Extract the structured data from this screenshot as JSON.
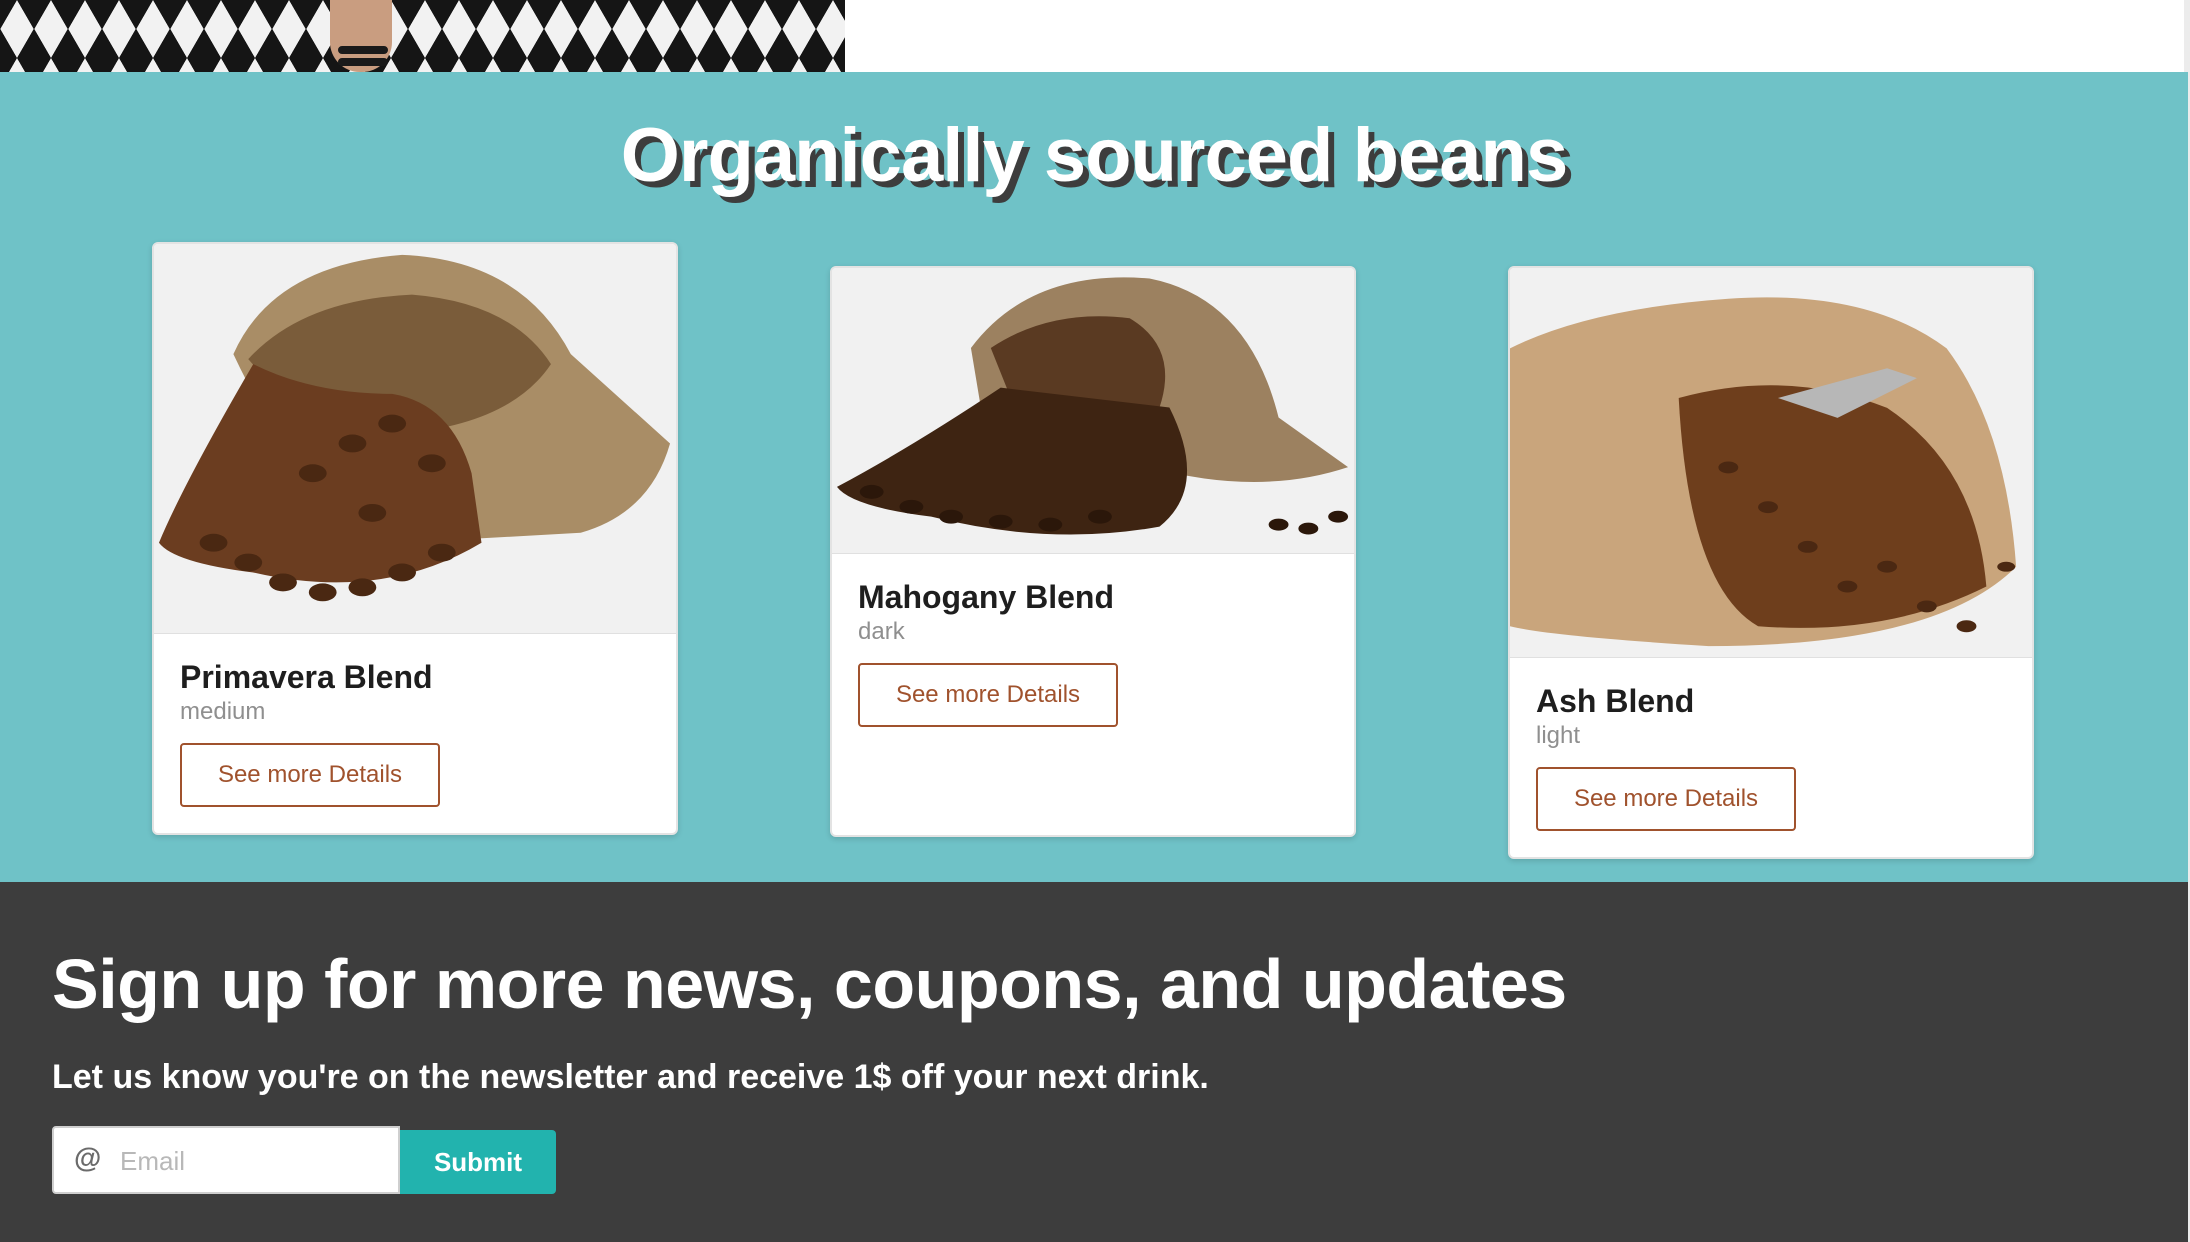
{
  "hero": {
    "image_alt": "hero-photo"
  },
  "beans": {
    "title": "Organically sourced beans",
    "cards": [
      {
        "name": "Primavera Blend",
        "roast": "medium",
        "button_label": "See more Details"
      },
      {
        "name": "Mahogany Blend",
        "roast": "dark",
        "button_label": "See more Details"
      },
      {
        "name": "Ash Blend",
        "roast": "light",
        "button_label": "See more Details"
      }
    ]
  },
  "newsletter": {
    "title": "Sign up for more news, coupons, and updates",
    "subtitle": "Let us know you're on the newsletter and receive 1$ off your next drink.",
    "email_icon": "@",
    "email_placeholder": "Email",
    "email_value": "",
    "submit_label": "Submit"
  },
  "colors": {
    "section_teal": "#6fc2c7",
    "newsletter_bg": "#3d3d3d",
    "button_brown": "#a0522d",
    "submit_teal": "#22b3ae"
  }
}
